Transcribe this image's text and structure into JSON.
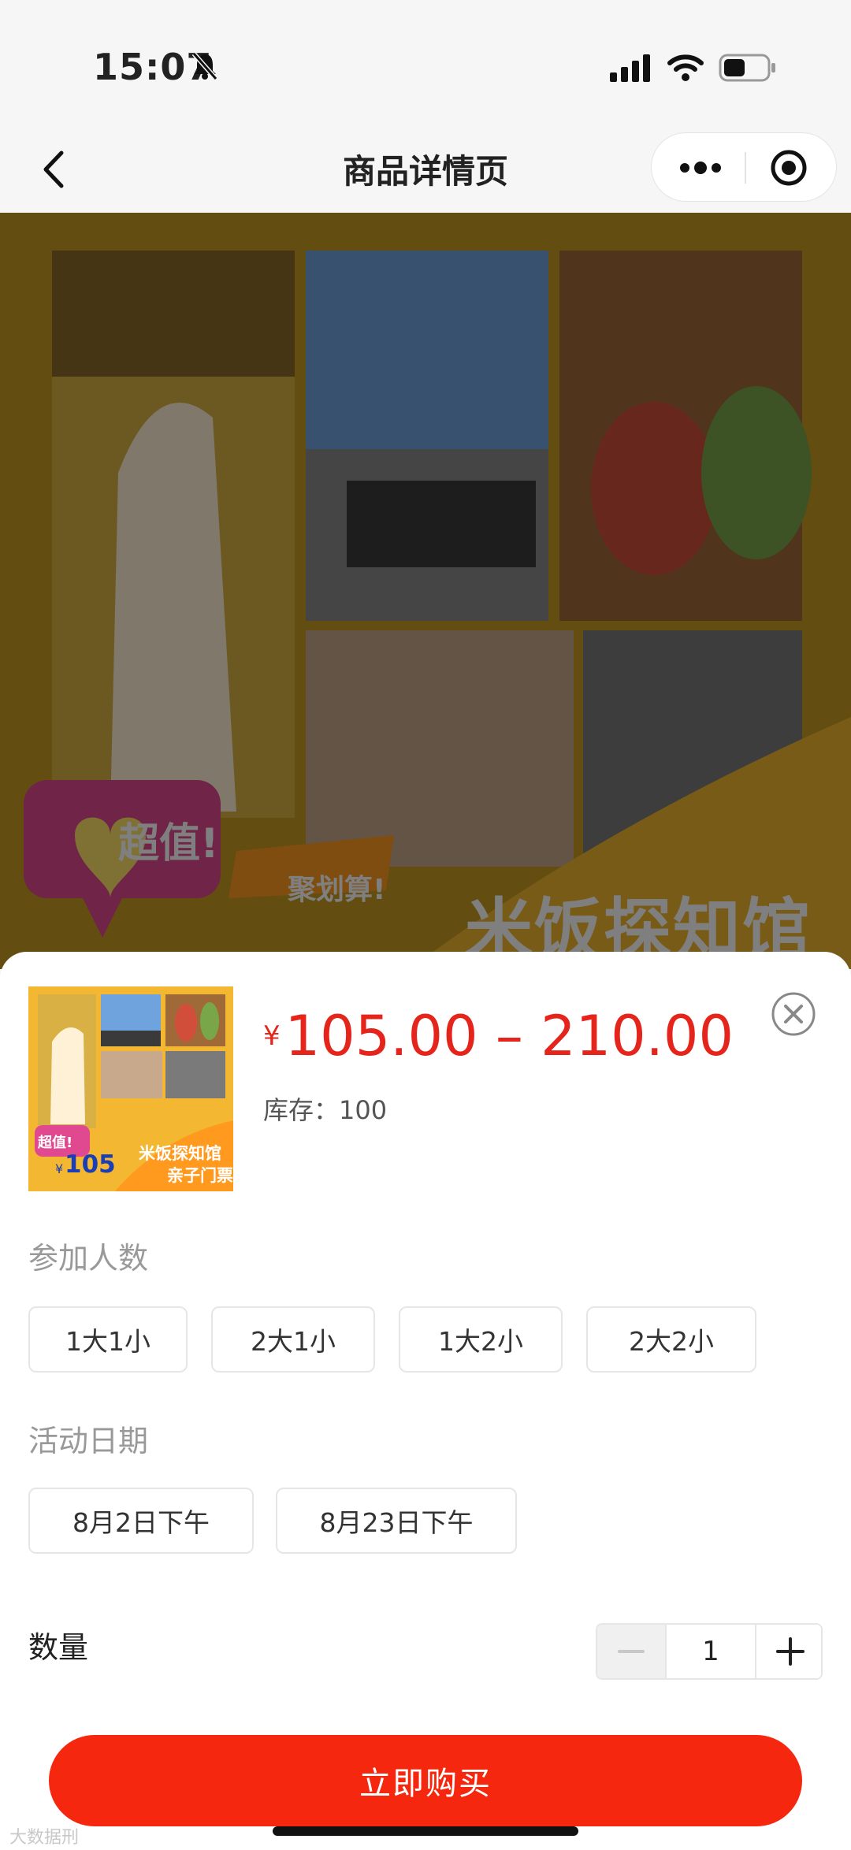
{
  "status_bar": {
    "time": "15:07",
    "icons": [
      "bell-muted-icon",
      "signal-icon",
      "wifi-icon",
      "battery-icon"
    ]
  },
  "nav": {
    "title": "商品详情页",
    "back_icon": "chevron-left-icon",
    "more_icon": "more-dots-icon",
    "target_icon": "target-circle-icon"
  },
  "hero": {
    "title": "米饭探知馆",
    "badge_primary": "超值!",
    "badge_secondary": "聚划算!"
  },
  "sheet": {
    "thumbnail": {
      "title_line1": "米饭探知馆",
      "title_line2": "亲子门票",
      "price_yen": "¥",
      "price": "105",
      "badge": "超值!"
    },
    "price_yen": "¥",
    "price_range": "105.00 – 210.00",
    "stock": "库存：100",
    "close_icon": "close-circle-icon",
    "groups": [
      {
        "label": "参加人数",
        "options": [
          "1大1小",
          "2大1小",
          "1大2小",
          "2大2小"
        ]
      },
      {
        "label": "活动日期",
        "options": [
          "8月2日下午",
          "8月23日下午"
        ]
      }
    ],
    "quantity": {
      "label": "数量",
      "value": "1",
      "minus_icon": "minus-icon",
      "plus_icon": "plus-icon"
    },
    "buy_button": "立即购买",
    "watermark": "大数据刑"
  },
  "colors": {
    "accent_red": "#f5270f",
    "price_red": "#e5251b",
    "hero_gold": "#c79b22"
  }
}
